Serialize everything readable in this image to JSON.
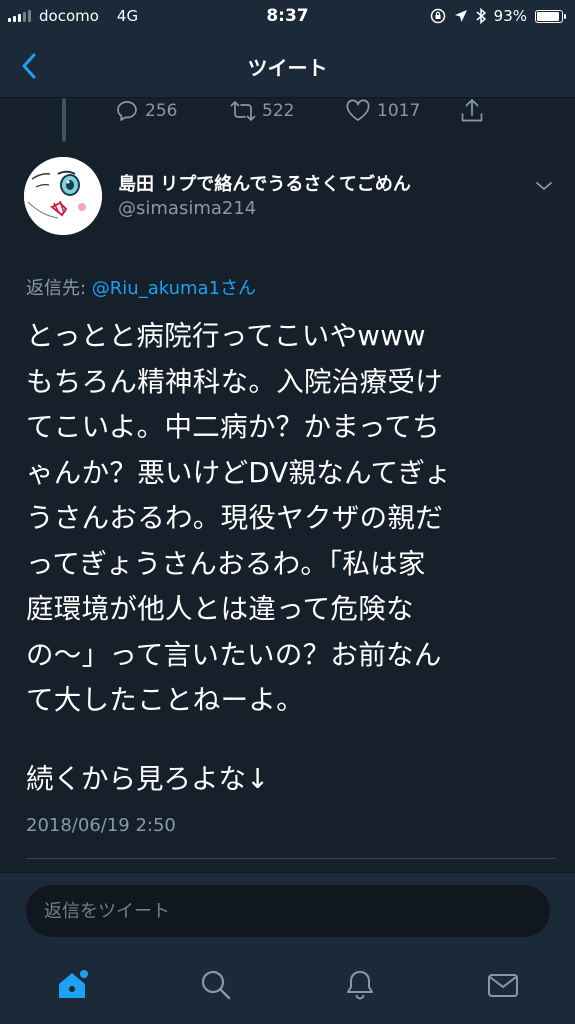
{
  "status_bar": {
    "carrier": "docomo",
    "network": "4G",
    "time": "8:37",
    "battery_percent": "93%",
    "battery_level": 0.93
  },
  "nav": {
    "title": "ツイート",
    "back_icon": "chevron-left-icon"
  },
  "actions": {
    "reply_count": "256",
    "retweet_count": "522",
    "like_count": "1017"
  },
  "author": {
    "name": "島田 リプで絡んでうるさくてごめん",
    "handle": "@simasima214"
  },
  "reply_to": {
    "prefix": "返信先: ",
    "mention": "@Riu_akuma1",
    "suffix": "さん"
  },
  "tweet": {
    "text": "とっとと病院行ってこいやwww\nもちろん精神科な。入院治療受け\nてこいよ。中二病か？かまってち\nゃんか？悪いけどDV親なんてぎょ\nうさんおるわ。現役ヤクザの親だ\nってぎょうさんおるわ。「私は家\n庭環境が他人とは違って危険な\nの〜」って言いたいの？お前なん\nて大したことねーよ。",
    "text_continued": "続くから見ろよな↓",
    "timestamp": "2018/06/19 2:50"
  },
  "composer": {
    "placeholder": "返信をツイート"
  },
  "colors": {
    "background": "#15202b",
    "bar_background": "#1c2938",
    "accent": "#1da1f2",
    "muted": "#8899a6"
  }
}
